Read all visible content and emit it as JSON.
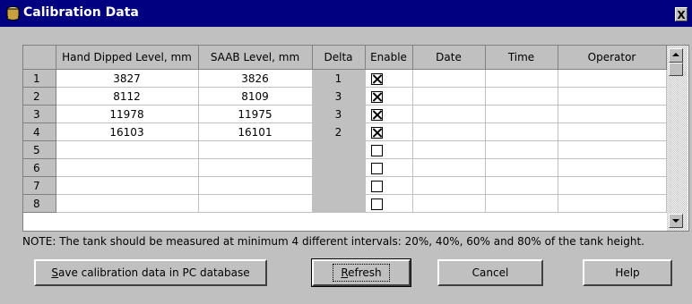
{
  "window": {
    "title": "Calibration Data",
    "close_glyph": "X"
  },
  "grid": {
    "columns": [
      "Hand Dipped Level, mm",
      "SAAB Level, mm",
      "Delta",
      "Enable",
      "Date",
      "Time",
      "Operator"
    ],
    "rows": [
      {
        "num": "1",
        "hand": "3827",
        "saab": "3826",
        "delta": "1",
        "enabled": true,
        "date": "",
        "time": "",
        "operator": ""
      },
      {
        "num": "2",
        "hand": "8112",
        "saab": "8109",
        "delta": "3",
        "enabled": true,
        "date": "",
        "time": "",
        "operator": ""
      },
      {
        "num": "3",
        "hand": "11978",
        "saab": "11975",
        "delta": "3",
        "enabled": true,
        "date": "",
        "time": "",
        "operator": ""
      },
      {
        "num": "4",
        "hand": "16103",
        "saab": "16101",
        "delta": "2",
        "enabled": true,
        "date": "",
        "time": "",
        "operator": ""
      },
      {
        "num": "5",
        "hand": "",
        "saab": "",
        "delta": "",
        "enabled": false,
        "date": "",
        "time": "",
        "operator": ""
      },
      {
        "num": "6",
        "hand": "",
        "saab": "",
        "delta": "",
        "enabled": false,
        "date": "",
        "time": "",
        "operator": ""
      },
      {
        "num": "7",
        "hand": "",
        "saab": "",
        "delta": "",
        "enabled": false,
        "date": "",
        "time": "",
        "operator": ""
      },
      {
        "num": "8",
        "hand": "",
        "saab": "",
        "delta": "",
        "enabled": false,
        "date": "",
        "time": "",
        "operator": ""
      }
    ]
  },
  "note": "NOTE: The tank should be measured at minimum 4 different intervals:  20%, 40%, 60% and 80% of the tank height.",
  "buttons": {
    "save": "Save calibration data in PC database",
    "refresh": "Refresh",
    "cancel": "Cancel",
    "help": "Help"
  }
}
